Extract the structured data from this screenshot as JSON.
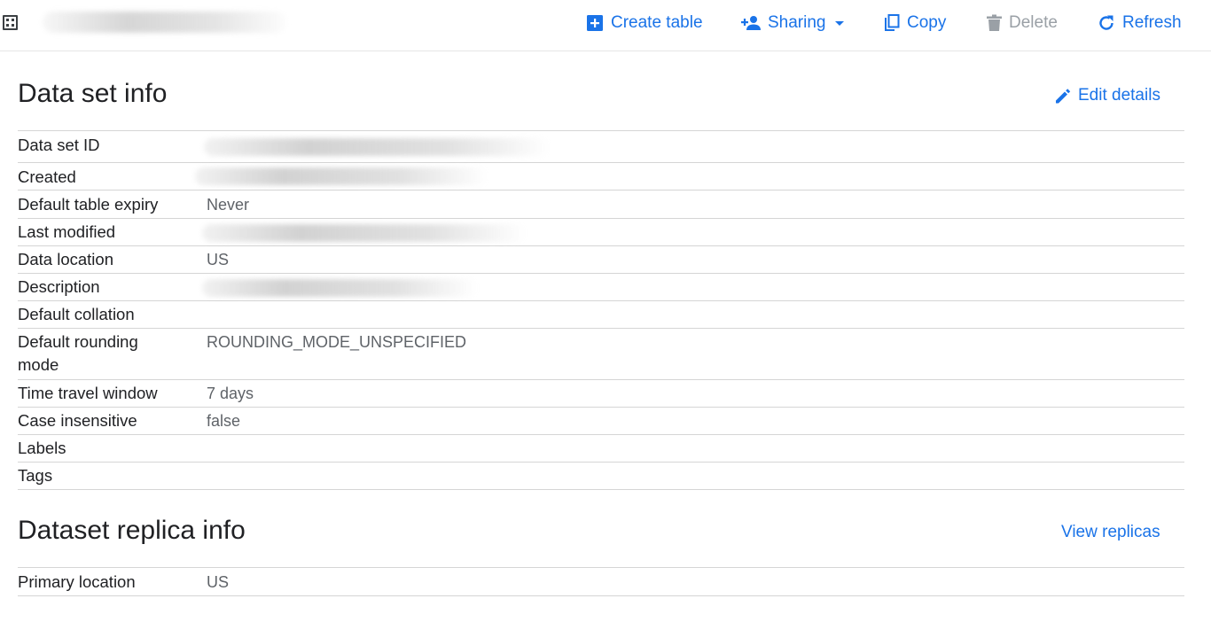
{
  "toolbar": {
    "dataset_icon": "dataset-icon",
    "dataset_name_redacted": true,
    "buttons": {
      "create_table": "Create table",
      "sharing": "Sharing",
      "copy": "Copy",
      "delete": "Delete",
      "refresh": "Refresh"
    }
  },
  "dataset_info": {
    "title": "Data set info",
    "edit_label": "Edit details",
    "rows": {
      "dataset_id": {
        "label": "Data set ID",
        "value": ""
      },
      "created": {
        "label": "Created",
        "value": ""
      },
      "default_table_expiry": {
        "label": "Default table expiry",
        "value": "Never"
      },
      "last_modified": {
        "label": "Last modified",
        "value": ""
      },
      "data_location": {
        "label": "Data location",
        "value": "US"
      },
      "description": {
        "label": "Description",
        "value": ""
      },
      "default_collation": {
        "label": "Default collation",
        "value": ""
      },
      "default_rounding_mode": {
        "label": "Default rounding mode",
        "value": "ROUNDING_MODE_UNSPECIFIED"
      },
      "time_travel_window": {
        "label": "Time travel window",
        "value": "7 days"
      },
      "case_insensitive": {
        "label": "Case insensitive",
        "value": "false"
      },
      "labels": {
        "label": "Labels",
        "value": ""
      },
      "tags": {
        "label": "Tags",
        "value": ""
      }
    }
  },
  "replica_info": {
    "title": "Dataset replica info",
    "view_label": "View replicas",
    "rows": {
      "primary_location": {
        "label": "Primary location",
        "value": "US"
      }
    }
  },
  "colors": {
    "accent": "#1a73e8",
    "disabled": "#9aa0a6",
    "text": "#202124",
    "value_text": "#5f6368",
    "divider": "#d5d5d5"
  }
}
